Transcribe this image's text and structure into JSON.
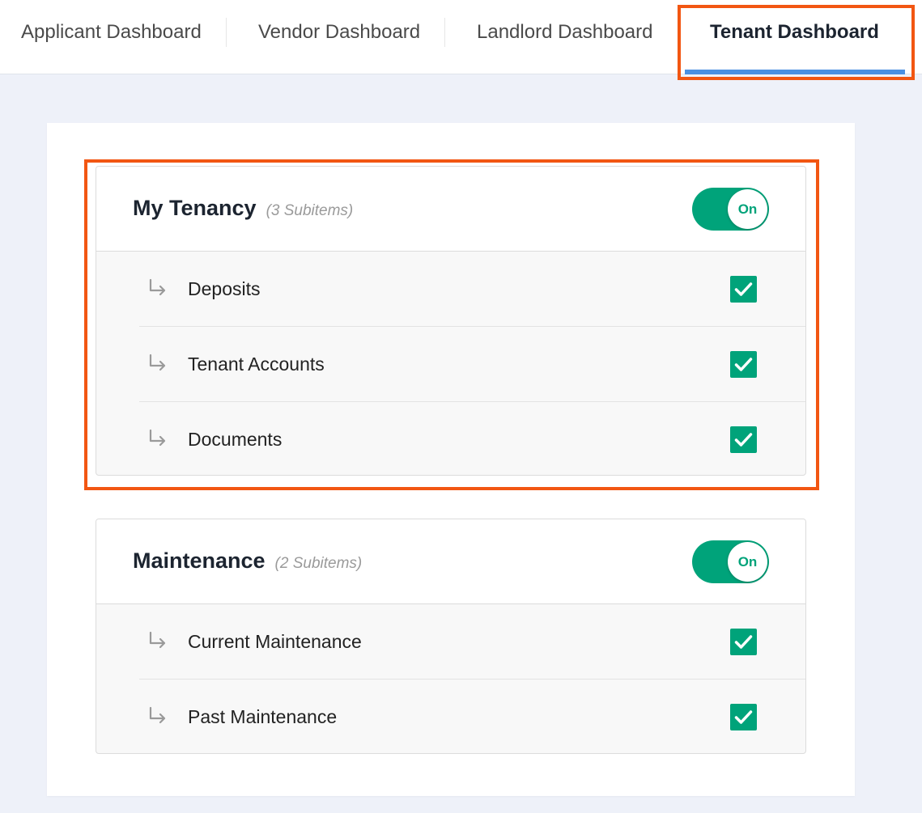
{
  "tabs": [
    {
      "label": "Applicant Dashboard",
      "active": false
    },
    {
      "label": "Vendor Dashboard",
      "active": false
    },
    {
      "label": "Landlord Dashboard",
      "active": false
    },
    {
      "label": "Tenant Dashboard",
      "active": true
    }
  ],
  "sections": [
    {
      "title": "My Tenancy",
      "count": "(3 Subitems)",
      "toggle": "On",
      "items": [
        {
          "label": "Deposits",
          "checked": true
        },
        {
          "label": "Tenant Accounts",
          "checked": true
        },
        {
          "label": "Documents",
          "checked": true
        }
      ]
    },
    {
      "title": "Maintenance",
      "count": "(2 Subitems)",
      "toggle": "On",
      "items": [
        {
          "label": "Current Maintenance",
          "checked": true
        },
        {
          "label": "Past Maintenance",
          "checked": true
        }
      ]
    }
  ],
  "colors": {
    "accent": "#00a37a",
    "active_tab_underline": "#4a90e2",
    "highlight": "#f25612",
    "background": "#eef1f9"
  }
}
